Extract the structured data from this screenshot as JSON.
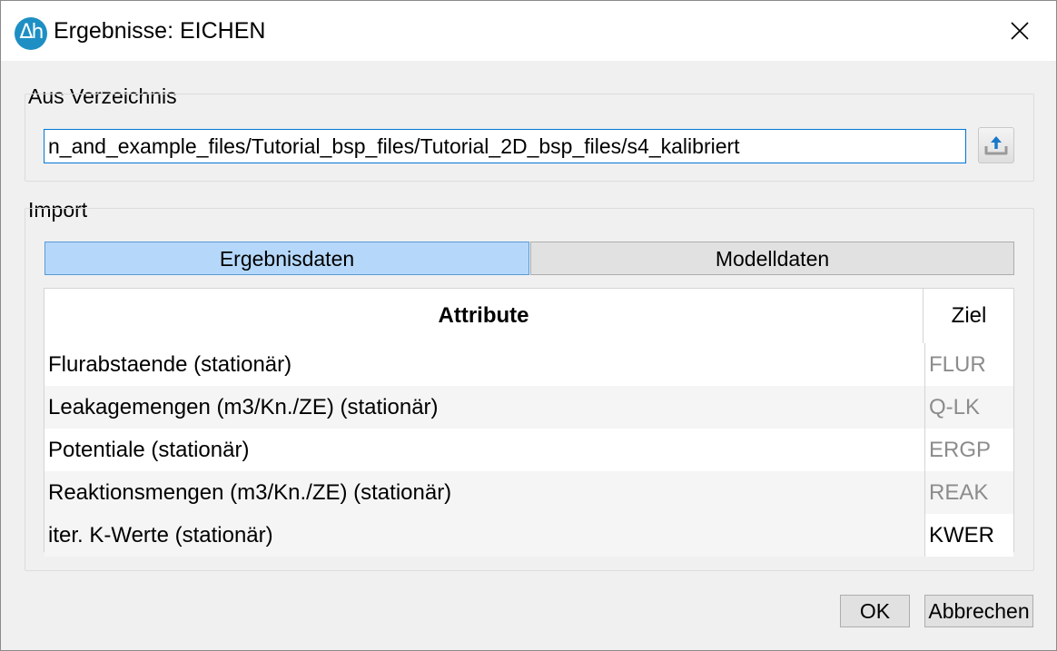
{
  "window": {
    "title": "Ergebnisse: EICHEN",
    "icon_text": "Δh",
    "icon_color": "#1e8fc4"
  },
  "directory": {
    "group_label": "Aus Verzeichnis",
    "path_value": "n_and_example_files/Tutorial_bsp_files/Tutorial_2D_bsp_files/s4_kalibriert",
    "browse_icon": "upload-folder-icon"
  },
  "import": {
    "group_label": "Import",
    "tabs": [
      {
        "label": "Ergebnisdaten",
        "active": true
      },
      {
        "label": "Modelldaten",
        "active": false
      }
    ],
    "table": {
      "headers": {
        "attribute": "Attribute",
        "ziel": "Ziel"
      },
      "rows": [
        {
          "attribute": "Flurabstaende (stationär)",
          "ziel": "FLUR"
        },
        {
          "attribute": "Leakagemengen (m3/Kn./ZE) (stationär)",
          "ziel": "Q-LK"
        },
        {
          "attribute": "Potentiale (stationär)",
          "ziel": "ERGP"
        },
        {
          "attribute": "Reaktionsmengen (m3/Kn./ZE) (stationär)",
          "ziel": "REAK"
        },
        {
          "attribute": "iter. K-Werte (stationär)",
          "ziel": "KWER"
        }
      ]
    }
  },
  "buttons": {
    "ok": "OK",
    "cancel": "Abbrechen"
  },
  "colors": {
    "active_tab": "#b5d8fa",
    "input_focus_border": "#0078d7"
  }
}
